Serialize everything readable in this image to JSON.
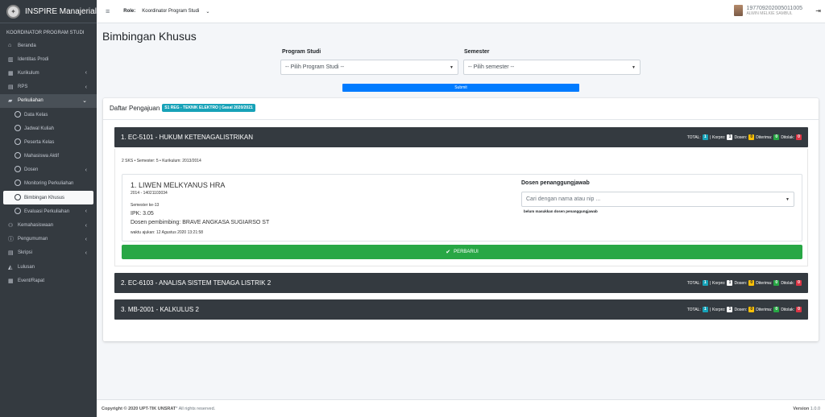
{
  "brand": {
    "title": "INSPIRE Manajerial"
  },
  "sidebar": {
    "header": "KOORDINATOR PROGRAM STUDI",
    "items": [
      {
        "label": "Beranda",
        "icon": "home-icon"
      },
      {
        "label": "Identitas Prodi",
        "icon": "institution-icon"
      },
      {
        "label": "Kurikulum",
        "icon": "table-icon"
      },
      {
        "label": "RPS",
        "icon": "file-icon"
      },
      {
        "label": "Perkuliahan",
        "icon": "briefcase-icon"
      },
      {
        "label": "Data Kelas"
      },
      {
        "label": "Jadwal Kuliah"
      },
      {
        "label": "Peserta Kelas"
      },
      {
        "label": "Mahasiswa Aktif"
      },
      {
        "label": "Dosen"
      },
      {
        "label": "Monitoring Perkuliahan"
      },
      {
        "label": "Bimbingan Khusus"
      },
      {
        "label": "Evaluasi Perkuliahan"
      },
      {
        "label": "Kemahasiswaan",
        "icon": "users-icon"
      },
      {
        "label": "Pengumuman",
        "icon": "info-icon"
      },
      {
        "label": "Skripsi",
        "icon": "document-icon"
      },
      {
        "label": "Lulusan",
        "icon": "graduation-icon"
      },
      {
        "label": "Event/Rapat",
        "icon": "calendar-icon"
      }
    ]
  },
  "navbar": {
    "role_label": "Role:",
    "role_value": "Koordinator Program Studi",
    "user_id": "197709202005011005",
    "user_name": "ALWIN MELKIE SAMBUL"
  },
  "page": {
    "title": "Bimbingan Khusus"
  },
  "filters": {
    "prodi_label": "Program Studi",
    "prodi_value": "-- Pilih Program Studi --",
    "semester_label": "Semester",
    "semester_value": "-- Pilih semester --",
    "submit_label": "Submit"
  },
  "daftar": {
    "label": "Daftar Pengajuan",
    "badge": "S1 REG - TEKNIK ELEKTRO | Gasal 2020/2021"
  },
  "stats_labels": {
    "total": "TOTAL:",
    "korpro": "Korpro:",
    "dosen": "Dosen:",
    "diterima": "Diterima:",
    "ditolak": "Ditolak:"
  },
  "courses": [
    {
      "title": "1. EC-5101 - HUKUM KETENAGALISTRIKAN",
      "total": "1",
      "korpro": "1",
      "dosen": "0",
      "diterima": "0",
      "ditolak": "0"
    },
    {
      "title": "2. EC-6103 - ANALISA SISTEM TENAGA LISTRIK 2",
      "total": "1",
      "korpro": "1",
      "dosen": "0",
      "diterima": "0",
      "ditolak": "0"
    },
    {
      "title": "3. MB-2001 - KALKULUS 2",
      "total": "1",
      "korpro": "1",
      "dosen": "0",
      "diterima": "0",
      "ditolak": "0"
    }
  ],
  "course1": {
    "meta": "2 SKS • Semester: 5 • Kurikulum: 2013/2014",
    "student_name": "1. LIWEN MELKYANUS HRA",
    "student_nim": "2014 - 14021103034",
    "semester": "Semester ke-13",
    "ipk": "IPK: 3.05",
    "pembimbing": "Dosen pembimbing: BRAVE ANGKASA SUGIARSO ST",
    "waktu": "waktu ajukan: 12 Agustus 2020 13:21:58",
    "dosen_label": "Dosen penanggungjawab",
    "dosen_placeholder": "Cari dengan nama atau nip ...",
    "dosen_warning": "belum masukkan dosen penanggungjawab",
    "update_label": "PERBARUI"
  },
  "footer": {
    "copyright_bold": "Copyright © 2020 UPT-TIK UNSRAT",
    "copyright_rest": " * All rights reserved.",
    "version_label": "Version",
    "version_value": "1.0.0"
  }
}
